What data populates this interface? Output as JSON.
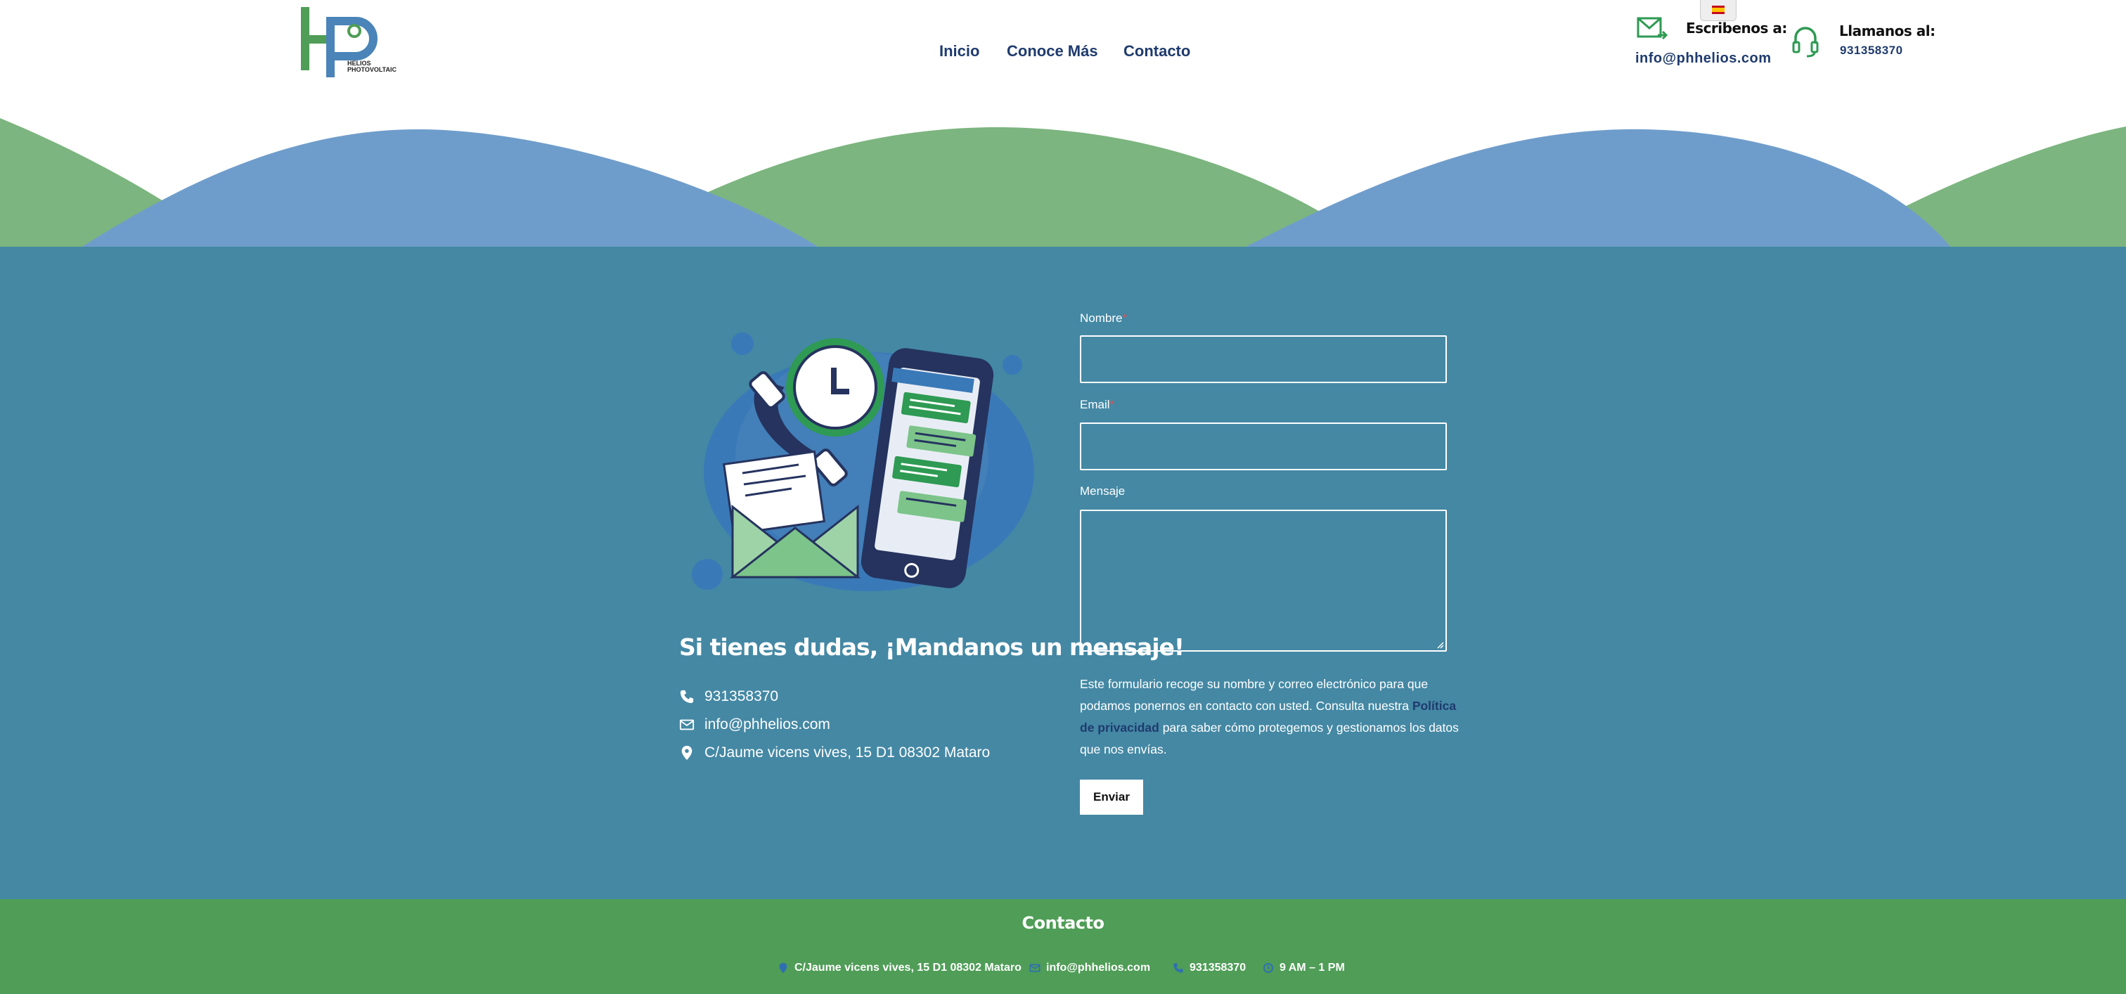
{
  "header": {
    "logo_text": [
      "HELIOS",
      "PHOTOVOLTAIC"
    ],
    "nav": [
      "Inicio",
      "Conoce Más",
      "Contacto"
    ],
    "email_label": "Escribenos a:",
    "email_value": "info@phhelios.com",
    "phone_label": "Llamanos al:",
    "phone_value": "931358370",
    "language": "es"
  },
  "contact": {
    "title": "Si tienes dudas, ¡Mandanos un mensaje!",
    "phone": "931358370",
    "email": "info@phhelios.com",
    "address": "C/Jaume vicens vives, 15 D1 08302 Mataro"
  },
  "form": {
    "name_label": "Nombre",
    "email_label": "Email",
    "message_label": "Mensaje",
    "required_mark": "*",
    "privacy_before": "Este formulario recoge su nombre y correo electrónico para que podamos ponernos en contacto con usted. Consulta nuestra ",
    "privacy_link": "Política de privacidad",
    "privacy_after": " para saber cómo protegemos y gestionamos los datos que nos envías.",
    "submit_label": "Enviar"
  },
  "footer": {
    "title": "Contacto",
    "address": "C/Jaume vicens vives, 15 D1 08302 Mataro",
    "email": "info@phhelios.com",
    "phone": "931358370",
    "hours": "9 AM – 1 PM"
  },
  "colors": {
    "main_bg": "#4488a4",
    "footer_bg": "#4f9d57",
    "wave_green": "#7cb57f",
    "wave_blue": "#6f9dcb",
    "nav_text": "#1f3b6e"
  }
}
